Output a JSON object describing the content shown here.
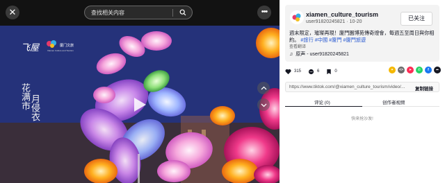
{
  "search": {
    "placeholder": "查找相关内容"
  },
  "video": {
    "calligraphy_left": "花满市",
    "calligraphy_right": "月侵衣",
    "logo_text": "飞屋",
    "logo2_name": "厦门文旅",
    "logo2_sub": "Xiamen Culture and Tourism"
  },
  "author": {
    "username": "xiamen_culture_tourism",
    "meta": "user91820245821 · 10-20",
    "follow_label": "已关注"
  },
  "post": {
    "text": "週末限定，璀璨再現！廈門園博苑傳奇燈會，每週五至周日與你相約。",
    "tags": [
      "#旅行",
      "#中國",
      "#廈門",
      "#廈門旅遊"
    ],
    "translate": "查看翻译",
    "sound": "原声 - user91820245821"
  },
  "stats": {
    "likes": "315",
    "comments": "6",
    "saves": "0"
  },
  "share": {
    "url": "https://www.tiktok.com/@xiamen_culture_tourism/video/...",
    "copy_label": "复制链接"
  },
  "tabs": [
    {
      "label": "评论 (0)"
    },
    {
      "label": "创作者视频"
    }
  ],
  "comments": {
    "empty_text": "快来抢沙发!"
  },
  "colors": {
    "tag": "#2b5bd1",
    "follow_border": "#d6d6d6"
  }
}
